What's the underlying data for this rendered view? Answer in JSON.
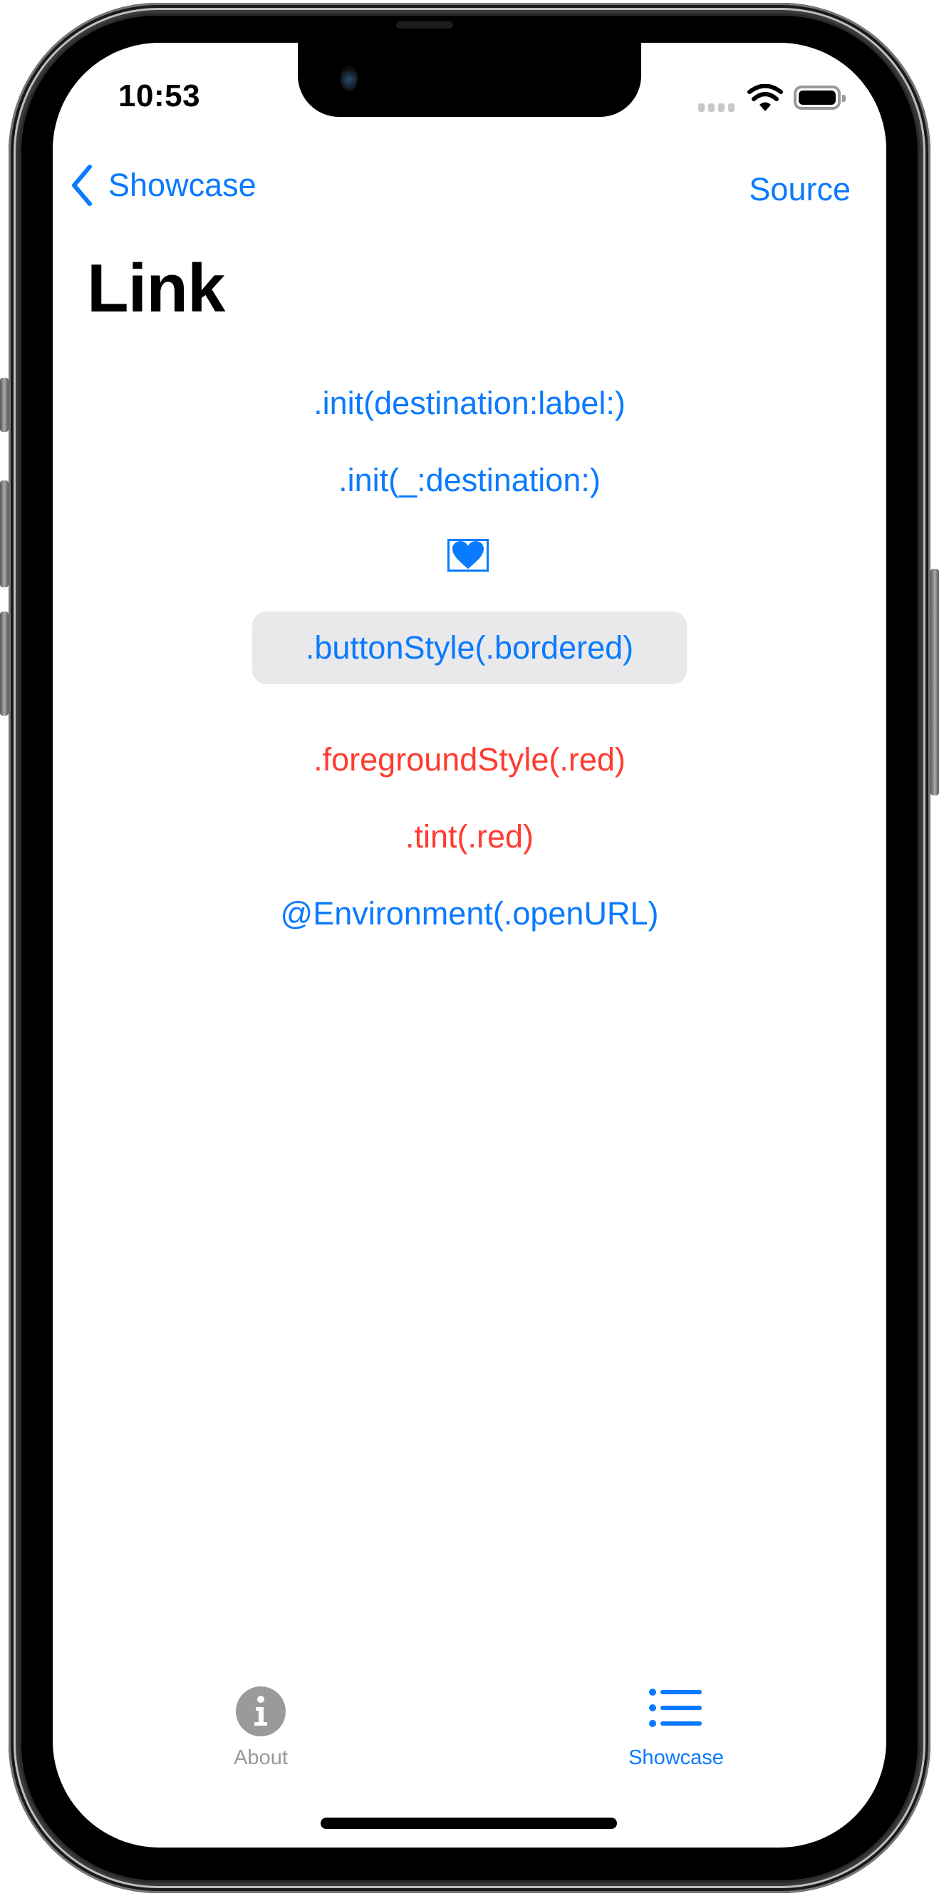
{
  "status_bar": {
    "time": "10:53",
    "signal_icon": "cellular-signal-icon",
    "wifi_icon": "wifi-icon",
    "battery_icon": "battery-full-icon"
  },
  "nav": {
    "back_label": "Showcase",
    "back_icon": "chevron-left-icon",
    "right_button_label": "Source",
    "title": "Link"
  },
  "colors": {
    "accent": "#0A7AFF",
    "red": "#FF3B30",
    "bordered_bg": "#E9E9EB",
    "tab_inactive": "#9A9A9A"
  },
  "content": {
    "items": [
      {
        "label": ".init(destination:label:)",
        "style": "plain",
        "color": "blue"
      },
      {
        "label": ".init(_:destination:)",
        "style": "plain",
        "color": "blue"
      },
      {
        "label": "",
        "icon": "heart-fill-icon",
        "style": "image-link",
        "color": "blue"
      },
      {
        "label": ".buttonStyle(.bordered)",
        "style": "bordered",
        "color": "blue"
      },
      {
        "label": ".foregroundStyle(.red)",
        "style": "plain",
        "color": "red"
      },
      {
        "label": ".tint(.red)",
        "style": "plain",
        "color": "red"
      },
      {
        "label": "@Environment(.openURL)",
        "style": "plain",
        "color": "blue"
      }
    ]
  },
  "tab_bar": {
    "tabs": [
      {
        "label": "About",
        "icon": "info-circle-icon",
        "selected": false
      },
      {
        "label": "Showcase",
        "icon": "list-bullet-icon",
        "selected": true
      }
    ]
  }
}
